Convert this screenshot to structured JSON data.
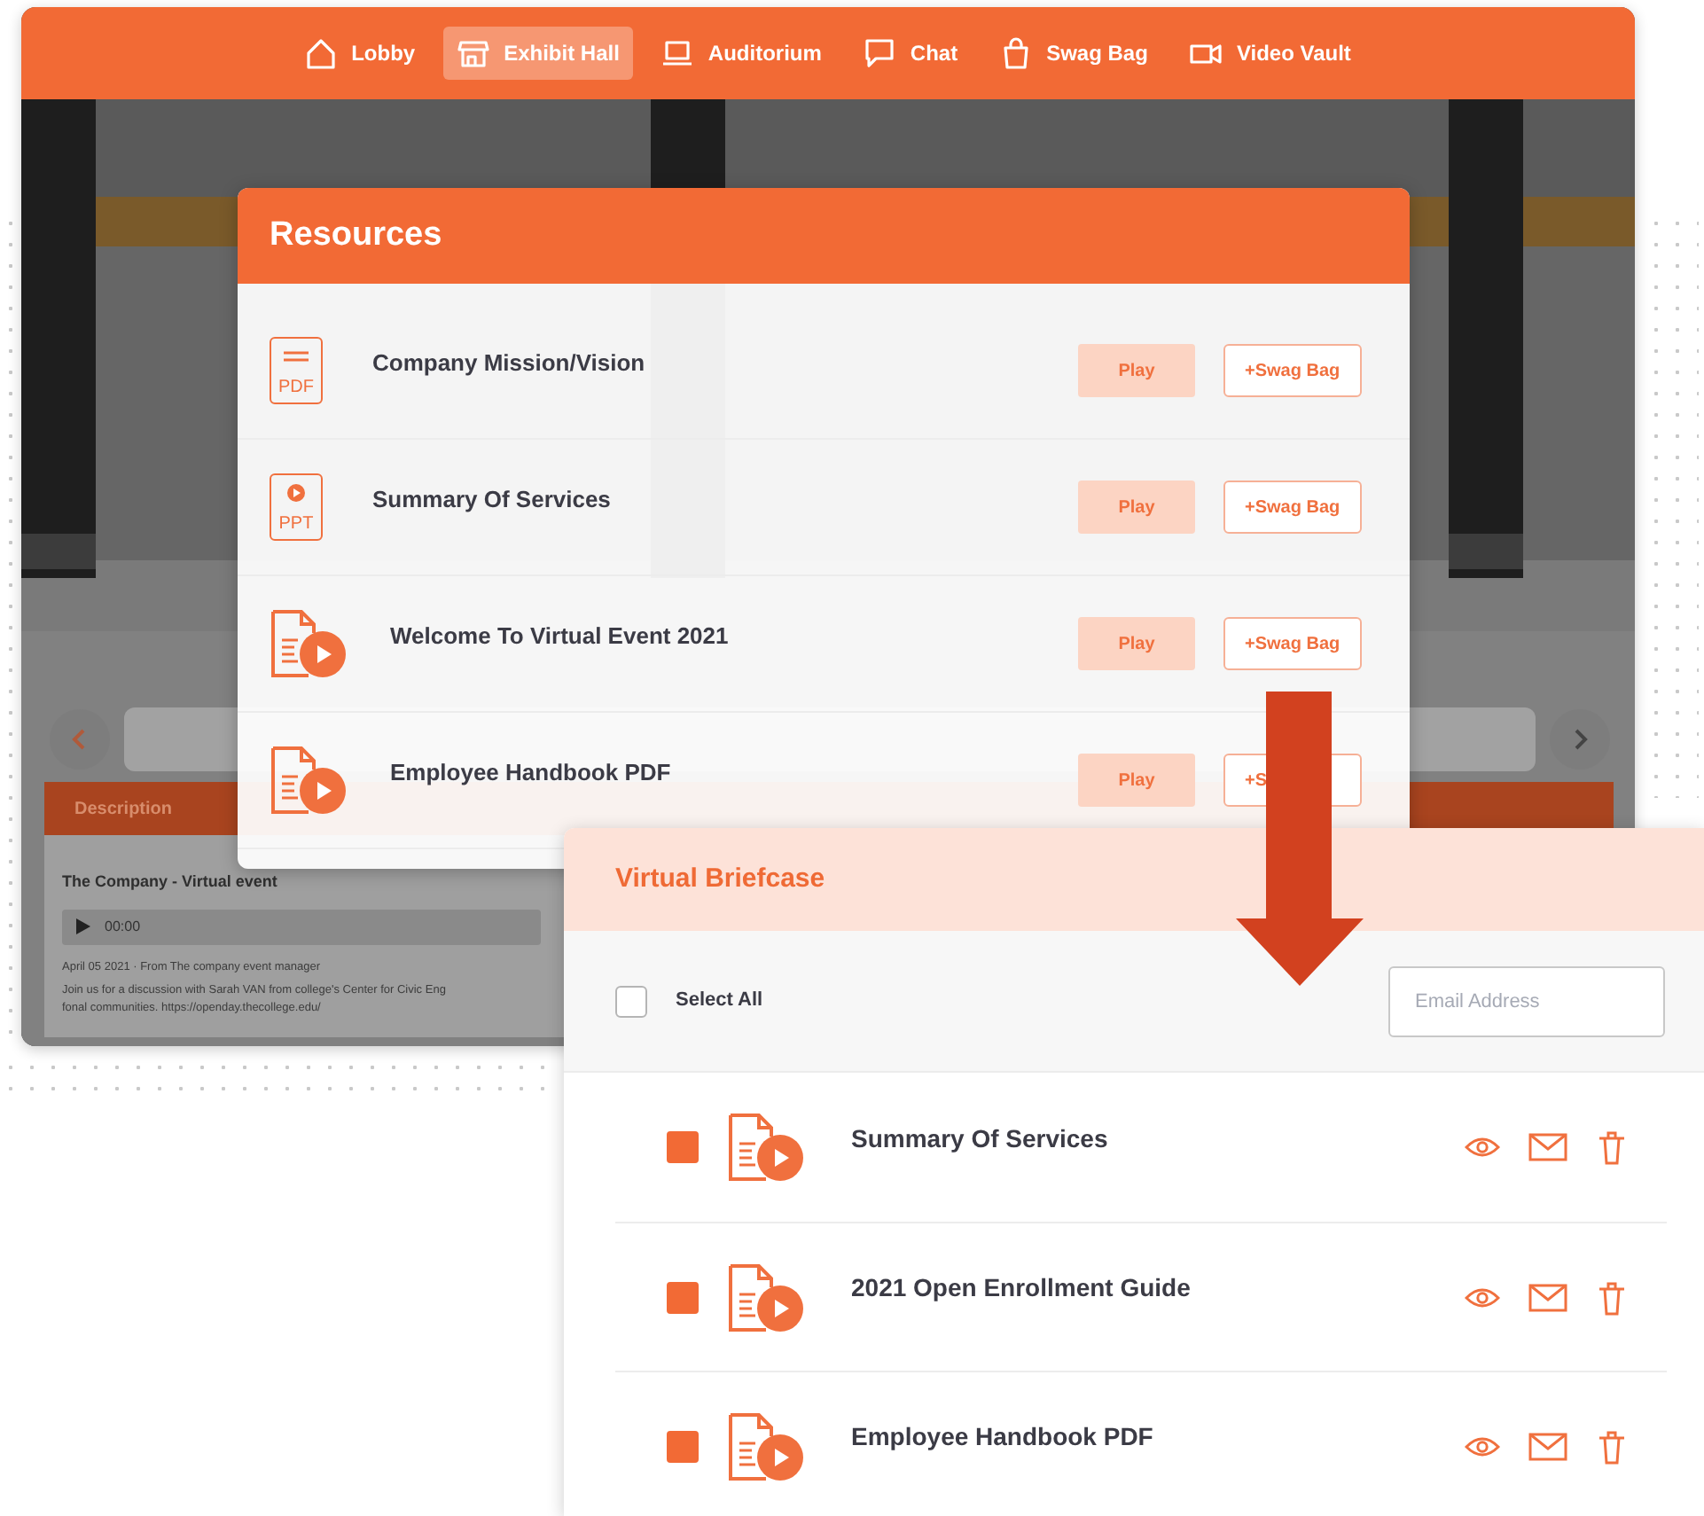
{
  "nav": {
    "items": [
      {
        "label": "Lobby",
        "selected": false
      },
      {
        "label": "Exhibit Hall",
        "selected": true
      },
      {
        "label": "Auditorium",
        "selected": false
      },
      {
        "label": "Chat",
        "selected": false
      },
      {
        "label": "Swag Bag",
        "selected": false
      },
      {
        "label": "Video Vault",
        "selected": false
      }
    ]
  },
  "hall": {
    "panel_tab": "Description",
    "event_title": "The Company - Virtual event",
    "player_time": "00:00",
    "meta": "April 05 2021 · From The company event manager",
    "description_lines": [
      "Join us for a discussion with Sarah VAN from college's Center for Civic Eng",
      "fonal communities. https://openday.thecollege.edu/"
    ]
  },
  "resources": {
    "title": "Resources",
    "items": [
      {
        "kind": "pdf",
        "icon_label": "PDF",
        "title": "Company Mission/Vision",
        "play": "Play",
        "swag": "+Swag Bag"
      },
      {
        "kind": "ppt",
        "icon_label": "PPT",
        "title": "Summary Of Services",
        "play": "Play",
        "swag": "+Swag Bag"
      },
      {
        "kind": "video",
        "title": "Welcome To Virtual Event 2021",
        "play": "Play",
        "swag": "+Swag Bag"
      },
      {
        "kind": "video",
        "title": "Employee Handbook PDF",
        "play": "Play",
        "swag": "+S"
      }
    ]
  },
  "briefcase": {
    "title": "Virtual Briefcase",
    "select_all": {
      "label": "Select All",
      "checked": false
    },
    "email": {
      "placeholder": "Email Address"
    },
    "items": [
      {
        "title": "Summary Of Services",
        "checked": true
      },
      {
        "title": "2021 Open Enrollment Guide",
        "checked": true
      },
      {
        "title": "Employee Handbook PDF",
        "checked": true
      }
    ]
  }
}
